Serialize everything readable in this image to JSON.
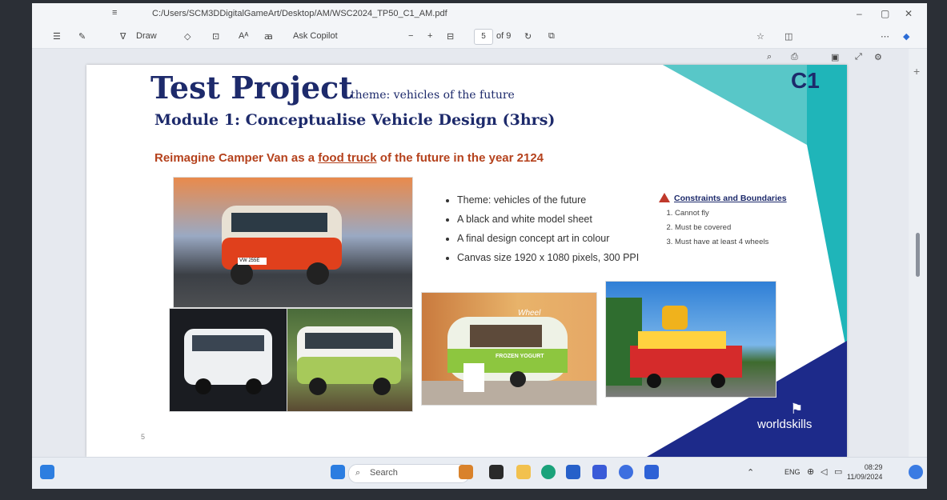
{
  "window": {
    "path": "C:/Users/SCM3DDigitalGameArt/Desktop/AM/WSC2024_TP50_C1_AM.pdf",
    "min": "–",
    "max": "▢",
    "close": "✕"
  },
  "toolbar": {
    "draw": "Draw",
    "ask_copilot": "Ask Copilot",
    "zoom_out": "−",
    "zoom_in": "+",
    "page_value": "5",
    "page_total": "of 9"
  },
  "slide": {
    "title": "Test Project",
    "theme": "theme: vehicles of the future",
    "module": "Module 1: Conceptualise Vehicle Design (3hrs)",
    "headline_pre": "Reimagine Camper Van as a ",
    "headline_link": "food truck",
    "headline_post": " of the future in the year 2124",
    "badge": "C1",
    "bullets": [
      "Theme: vehicles of the future",
      "A black and white model sheet",
      "A final design concept art in colour",
      "Canvas size 1920 x 1080 pixels, 300 PPI"
    ],
    "constraints_title": "Constraints and Boundaries",
    "constraints": [
      "Cannot fly",
      "Must be covered",
      "Must have at least 4 wheels"
    ],
    "page_number": "5",
    "logo_text": "worldskills",
    "photo_texts": {
      "plate": "VW 255E",
      "frozen": "FROZEN YOGURT",
      "truck_sign": "Wheel"
    }
  },
  "taskbar": {
    "search": "Search",
    "lang": "ENG",
    "time": "08:29",
    "date": "11/09/2024"
  },
  "colors": {
    "navy": "#1d2a6b",
    "teal": "#1fb5b9",
    "headline": "#b5421d"
  }
}
